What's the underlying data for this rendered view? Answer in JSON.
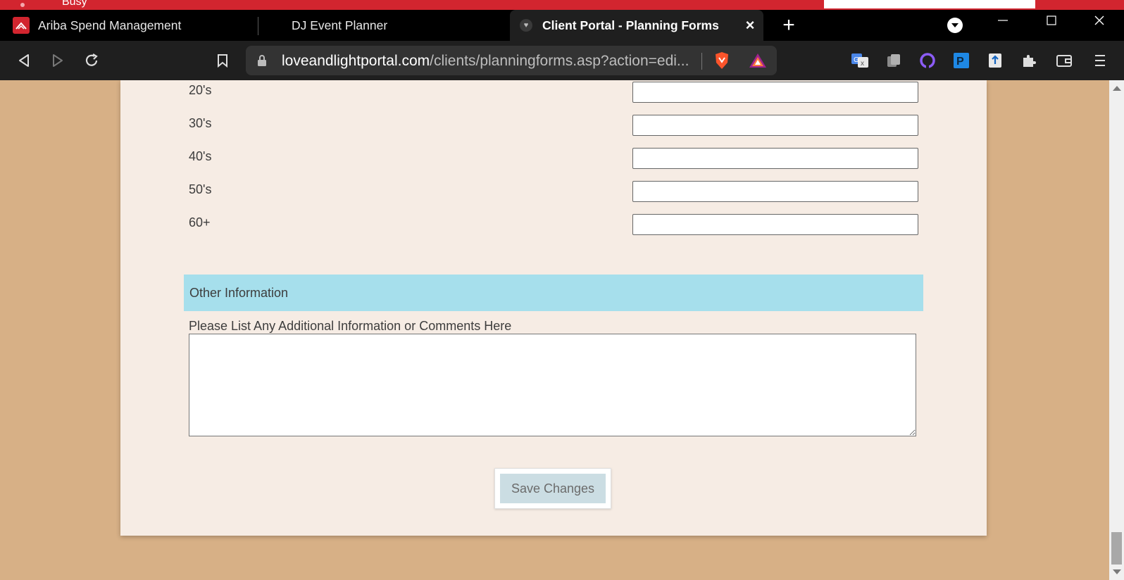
{
  "background_app": {
    "status_text": "Busy"
  },
  "tabs": [
    {
      "label": "Ariba Spend Management",
      "icon": "ariba-logo-icon",
      "active": false
    },
    {
      "label": "DJ Event Planner",
      "icon": "dj-favicon-icon",
      "active": false
    },
    {
      "label": "Client Portal - Planning Forms",
      "icon": "client-portal-favicon-icon",
      "active": true
    }
  ],
  "address_bar": {
    "domain": "loveandlightportal.com",
    "path": "/clients/planningforms.asp?action=edi..."
  },
  "form": {
    "age_groups": [
      {
        "label": "20's",
        "value": ""
      },
      {
        "label": "30's",
        "value": ""
      },
      {
        "label": "40's",
        "value": ""
      },
      {
        "label": "50's",
        "value": ""
      },
      {
        "label": "60+",
        "value": ""
      }
    ],
    "other_info": {
      "heading": "Other Information",
      "comments_label": "Please List Any Additional Information or Comments Here",
      "comments_value": ""
    },
    "save_label": "Save Changes"
  },
  "colors": {
    "page_bg": "#d7b086",
    "card_bg": "#f6ece4",
    "section_header_bg": "#a6dfec",
    "save_button_bg": "#cbdde3",
    "browser_chrome": "#1f1f1f",
    "accent_red": "#d2252f"
  }
}
